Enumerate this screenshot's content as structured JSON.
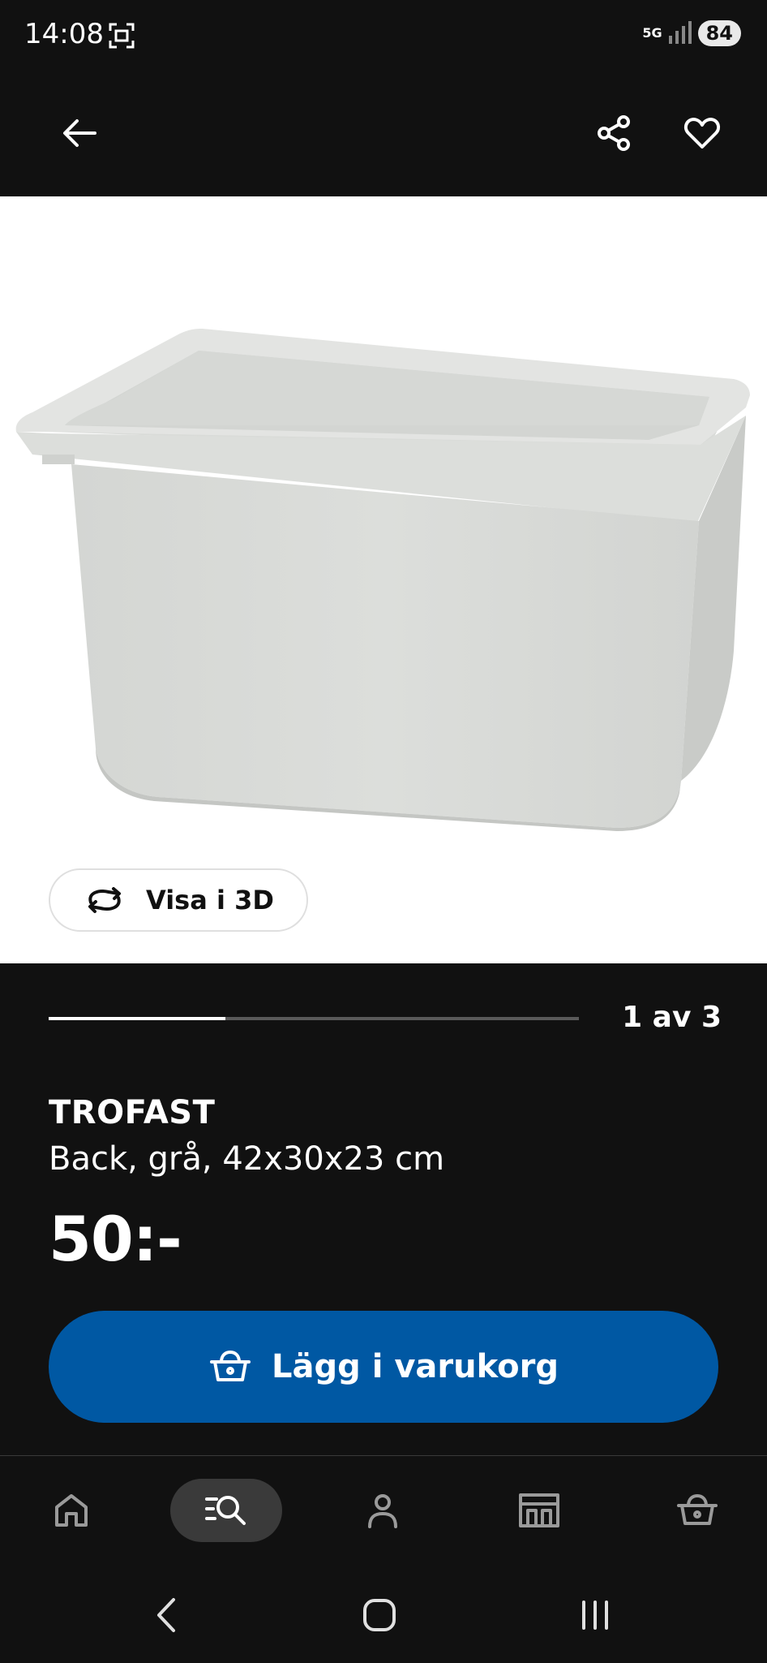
{
  "status_bar": {
    "time": "14:08",
    "network": "5G",
    "battery": "84"
  },
  "icons": {
    "back": "arrow-left-icon",
    "share": "share-icon",
    "favorite": "heart-icon",
    "rotate_3d": "rotate-icon",
    "cart": "basket-icon",
    "nav_home": "home-icon",
    "nav_search": "search-list-icon",
    "nav_profile": "person-icon",
    "nav_store": "store-icon",
    "nav_cart": "basket-icon"
  },
  "gallery": {
    "view_3d_label": "Visa i 3D",
    "progress_text": "1 av 3",
    "current": 1,
    "total": 3
  },
  "product": {
    "name": "TROFAST",
    "description": "Back, grå, 42x30x23 cm",
    "price": "50:-"
  },
  "actions": {
    "add_to_cart_label": "Lägg i varukorg"
  },
  "colors": {
    "background": "#111111",
    "accent_blue": "#0058a3",
    "image_background": "#ffffff",
    "nav_active_pill": "#3a3a3a"
  }
}
